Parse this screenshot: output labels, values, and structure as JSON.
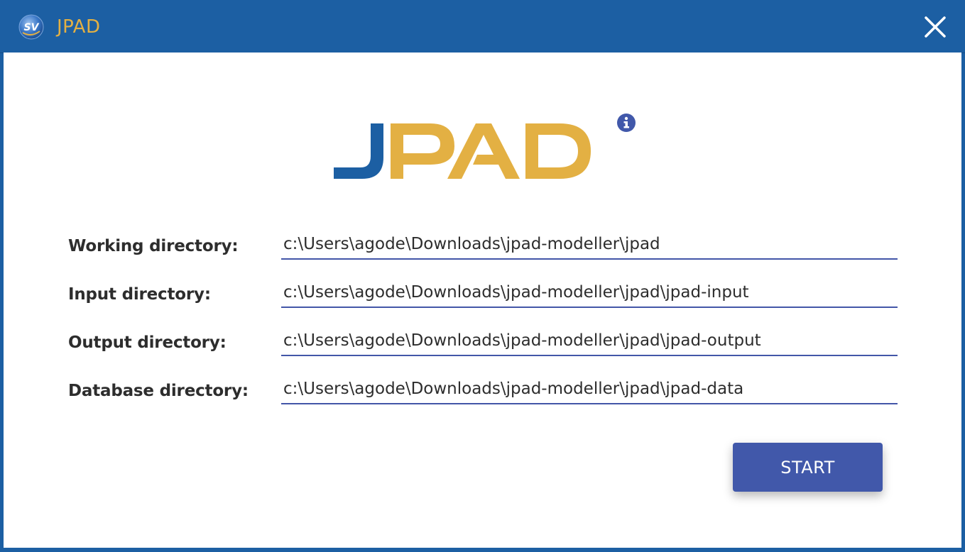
{
  "window": {
    "title": "JPAD",
    "app_icon": "sv-app-icon",
    "close_icon": "close-icon"
  },
  "logo": {
    "text_first": "J",
    "text_rest": "PAD",
    "first_color": "#1c5fa3",
    "rest_color": "#e3b043",
    "info_icon": "info-icon"
  },
  "fields": [
    {
      "label": "Working directory:",
      "value": "c:\\Users\\agode\\Downloads\\jpad-modeller\\jpad"
    },
    {
      "label": "Input directory:",
      "value": "c:\\Users\\agode\\Downloads\\jpad-modeller\\jpad\\jpad-input"
    },
    {
      "label": "Output directory:",
      "value": "c:\\Users\\agode\\Downloads\\jpad-modeller\\jpad\\jpad-output"
    },
    {
      "label": "Database directory:",
      "value": "c:\\Users\\agode\\Downloads\\jpad-modeller\\jpad\\jpad-data"
    }
  ],
  "start_button": {
    "label": "START"
  },
  "colors": {
    "titlebar": "#1c5fa3",
    "title_text": "#e3b043",
    "accent": "#4158aa",
    "underline": "#4356a8"
  }
}
